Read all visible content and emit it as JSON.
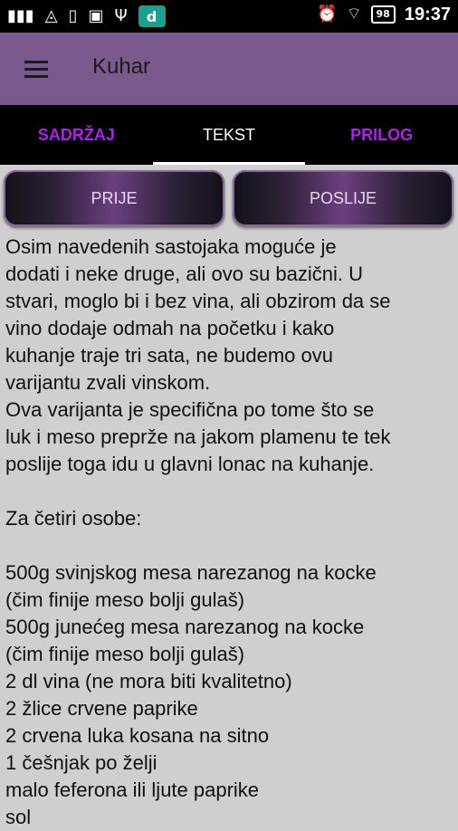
{
  "status_bar": {
    "battery": "98",
    "time": "19:37"
  },
  "app": {
    "title": "Kuhar"
  },
  "tabs": [
    {
      "label": "SADRŽAJ"
    },
    {
      "label": "TEKST"
    },
    {
      "label": "PRILOG"
    }
  ],
  "buttons": {
    "prev_label": "PRIJE",
    "next_label": "POSLIJE"
  },
  "content": {
    "lines": [
      "Osim navedenih sastojaka moguće je",
      "dodati i neke druge, ali ovo su bazični. U",
      "stvari, moglo bi i bez vina, ali obzirom da se",
      "vino dodaje odmah na početku i kako",
      "kuhanje traje tri sata, ne budemo ovu",
      "varijantu zvali vinskom.",
      "Ova varijanta je specifična po tome što se",
      "luk i meso preprže na jakom plamenu te tek",
      "poslije toga idu u glavni lonac na kuhanje.",
      "",
      "Za četiri osobe:",
      "",
      "500g svinjskog mesa narezanog na kocke",
      "(čim finije meso bolji gulaš)",
      "500g junećeg mesa narezanog na kocke",
      "(čim finije meso bolji gulaš)",
      "2 dl vina (ne mora biti kvalitetno)",
      "2 žlice crvene paprike",
      "2 crvena luka kosana na sitno",
      "1 češnjak po želji",
      "malo feferona ili ljute paprike",
      "sol"
    ]
  }
}
